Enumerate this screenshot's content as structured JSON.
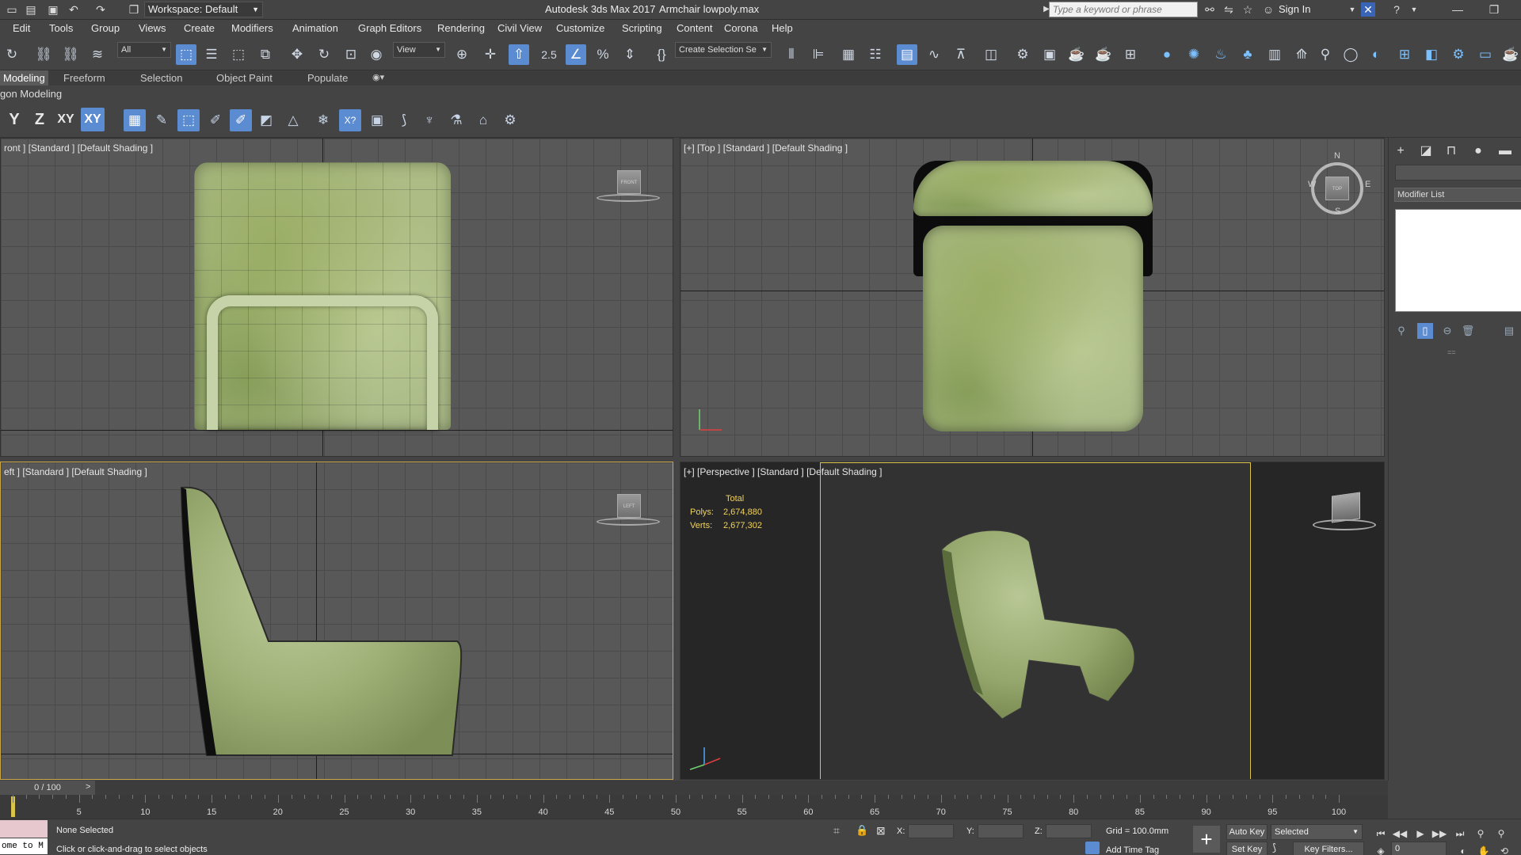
{
  "title_bar": {
    "workspace_label": "Workspace: Default",
    "app_title": "Autodesk 3ds Max 2017",
    "file_name": "Armchair lowpoly.max",
    "search_placeholder": "Type a keyword or phrase",
    "sign_in": "Sign In",
    "icons": [
      "new-file-icon",
      "open-file-icon",
      "save-icon",
      "undo-icon",
      "redo-icon",
      "project-icon",
      "binoculars-icon",
      "star-icon",
      "user-icon",
      "exchange-icon",
      "help-icon"
    ]
  },
  "menu": [
    "Edit",
    "Tools",
    "Group",
    "Views",
    "Create",
    "Modifiers",
    "Animation",
    "Graph Editors",
    "Rendering",
    "Civil View",
    "Customize",
    "Scripting",
    "Content",
    "Corona",
    "Help"
  ],
  "main_toolbar": {
    "filter_value": "All",
    "coordinate_system": "View",
    "named_selection": "Create Selection Se",
    "snap_label": "2.5",
    "percent_snap": "%"
  },
  "ribbon": {
    "tabs": [
      "Modeling",
      "Freeform",
      "Selection",
      "Object Paint",
      "Populate"
    ],
    "active_tab": "Modeling",
    "panel_label": "gon Modeling"
  },
  "axis_toolbar": {
    "axes": [
      "Y",
      "Z",
      "XY",
      "XY"
    ]
  },
  "viewports": {
    "front": {
      "label": "ront ] [Standard ] [Default Shading ]",
      "cube_text": "FRONT"
    },
    "top": {
      "label": "[+] [Top ] [Standard ] [Default Shading ]",
      "cube_text": "TOP",
      "compass": [
        "N",
        "S",
        "W",
        "E"
      ]
    },
    "left": {
      "label": "eft ] [Standard ] [Default Shading ]",
      "cube_text": "LEFT"
    },
    "perspective": {
      "label": "[+] [Perspective ] [Standard ] [Default Shading ]",
      "stats": {
        "heading": "Total",
        "polys_label": "Polys:",
        "polys": "2,674,880",
        "verts_label": "Verts:",
        "verts": "2,677,302"
      }
    }
  },
  "command_panel": {
    "tabs": [
      "create-icon",
      "modify-icon",
      "hierarchy-icon",
      "motion-icon",
      "display-icon"
    ],
    "modifier_list_label": "Modifier List",
    "divider": "=="
  },
  "timeline": {
    "frame_counter": "0 / 100",
    "next_arrow": ">",
    "ticks": [
      "5",
      "10",
      "15",
      "20",
      "25",
      "30",
      "35",
      "40",
      "45",
      "50",
      "55",
      "60",
      "65",
      "70",
      "75",
      "80",
      "85",
      "90",
      "95",
      "100"
    ],
    "current_frame": 0
  },
  "status_bar": {
    "maxscript_text": "ome to M",
    "selection_status": "None Selected",
    "prompt": "Click or click-and-drag to select objects",
    "x_label": "X:",
    "y_label": "Y:",
    "z_label": "Z:",
    "grid": "Grid = 100.0mm",
    "add_time_tag": "Add Time Tag",
    "auto_key": "Auto Key",
    "set_key": "Set Key",
    "key_filters": "Key Filters...",
    "selected": "Selected",
    "frame_value": "0"
  },
  "colors": {
    "accent_blue": "#5b8bd1",
    "active_viewport_border": "#d9c54a",
    "stats_yellow": "#f2d35e",
    "viewport_grid_bg": "#585858",
    "perspective_bg": "#2e2e2e",
    "fabric_green": "#a9b986"
  }
}
